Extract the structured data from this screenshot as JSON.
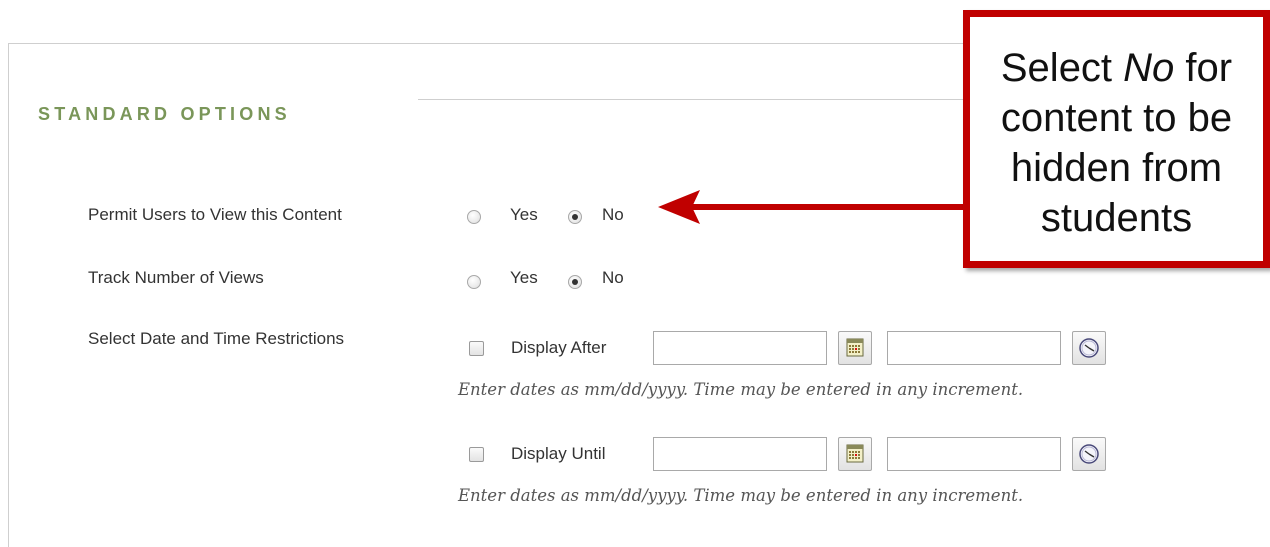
{
  "section": {
    "title": "STANDARD OPTIONS"
  },
  "permit": {
    "label": "Permit Users to View this Content",
    "yes": "Yes",
    "no": "No",
    "selected": "No"
  },
  "track": {
    "label": "Track Number of Views",
    "yes": "Yes",
    "no": "No",
    "selected": "No"
  },
  "restrictions": {
    "label": "Select Date and Time Restrictions",
    "after": {
      "checkbox_label": "Display After",
      "checked": false,
      "date_value": "",
      "time_value": ""
    },
    "until": {
      "checkbox_label": "Display Until",
      "checked": false,
      "date_value": "",
      "time_value": ""
    },
    "hint": "Enter dates as mm/dd/yyyy. Time may be entered in any increment."
  },
  "icons": {
    "date_picker": "calendar-icon",
    "time_picker": "clock-icon"
  },
  "callout": {
    "line1_pre": "Select ",
    "line1_em": "No",
    "line1_post": " for",
    "line2": "content to be",
    "line3": "hidden from",
    "line4": "students",
    "color": "#c00000"
  }
}
